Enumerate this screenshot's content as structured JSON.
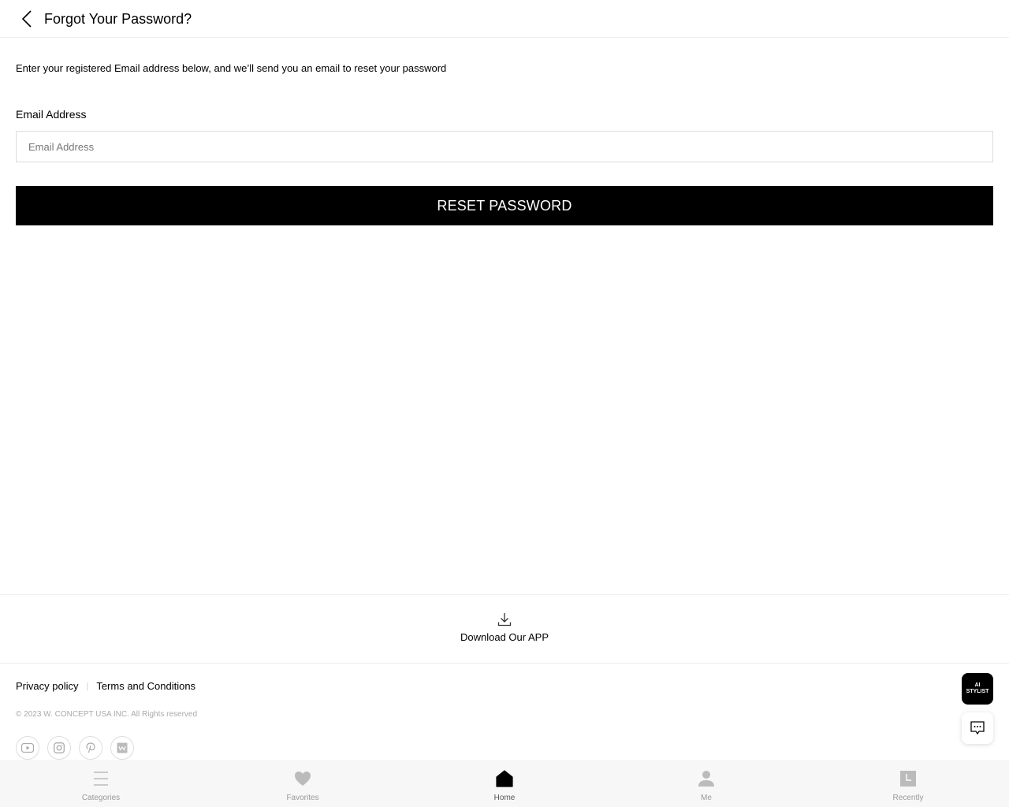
{
  "header": {
    "title": "Forgot Your Password?",
    "back_icon": "chevron-left-icon"
  },
  "form": {
    "intro_text": "Enter your registered Email address below, and we’ll send you an email to reset your password",
    "email_label": "Email Address",
    "email_placeholder": "Email Address",
    "email_value": "",
    "submit_label": "RESET PASSWORD"
  },
  "download": {
    "icon": "download-icon",
    "label": "Download Our APP"
  },
  "footer": {
    "privacy_label": "Privacy policy",
    "separator": "|",
    "terms_label": "Terms and Conditions",
    "copyright": "© 2023 W. CONCEPT USA INC. All Rights reserved",
    "socials": [
      "youtube-icon",
      "instagram-icon",
      "pinterest-icon",
      "wconcept-icon"
    ]
  },
  "floating": {
    "ai_line1": "AI",
    "ai_line2": "STYLIST",
    "chat_icon": "chat-icon"
  },
  "bottom_nav": {
    "items": [
      {
        "label": "Categories",
        "icon": "menu-icon"
      },
      {
        "label": "Favorites",
        "icon": "heart-icon"
      },
      {
        "label": "Home",
        "icon": "home-icon"
      },
      {
        "label": "Me",
        "icon": "person-icon"
      },
      {
        "label": "Recently",
        "icon": "recent-icon"
      }
    ],
    "active": "Home"
  },
  "colors": {
    "primary": "#000000",
    "border": "#dcdcdc",
    "muted": "#999999",
    "nav_bg": "#f7f7f7"
  }
}
